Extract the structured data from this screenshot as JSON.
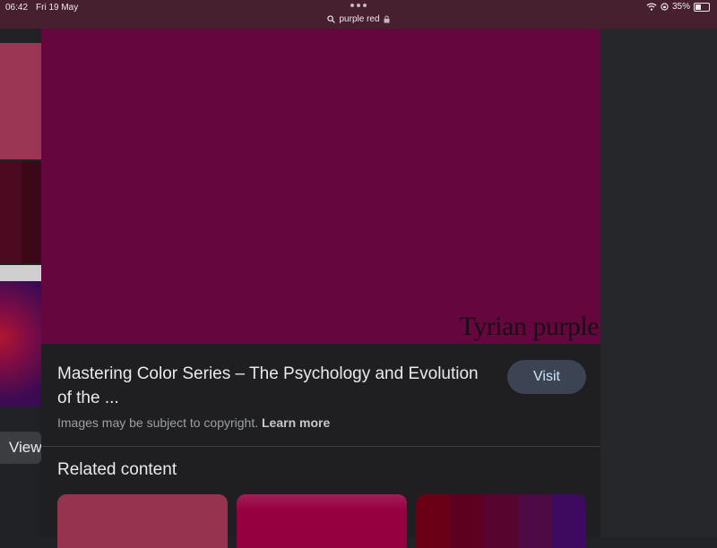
{
  "status_bar": {
    "time": "06:42",
    "date": "Fri 19 May",
    "url": "purple red",
    "battery": "35%",
    "battery_level": 0.35
  },
  "colors": {
    "preview": "#66063e",
    "status_bar_bg": "#46202f",
    "visit_button_bg": "#3c4454"
  },
  "left_strip": {
    "view_label": "View"
  },
  "preview": {
    "caption": "Tyrian purple"
  },
  "result": {
    "title": "Mastering Color Series – The Psychology and Evolution of the ...",
    "visit_label": "Visit",
    "copyright_text": "Images may be subject to copyright.",
    "learn_more_label": "Learn more"
  },
  "related": {
    "heading": "Related content"
  },
  "icons": [
    "search-icon",
    "lock-icon",
    "wifi-icon",
    "orientation-lock-icon",
    "battery-icon",
    "more-dots-icon"
  ]
}
